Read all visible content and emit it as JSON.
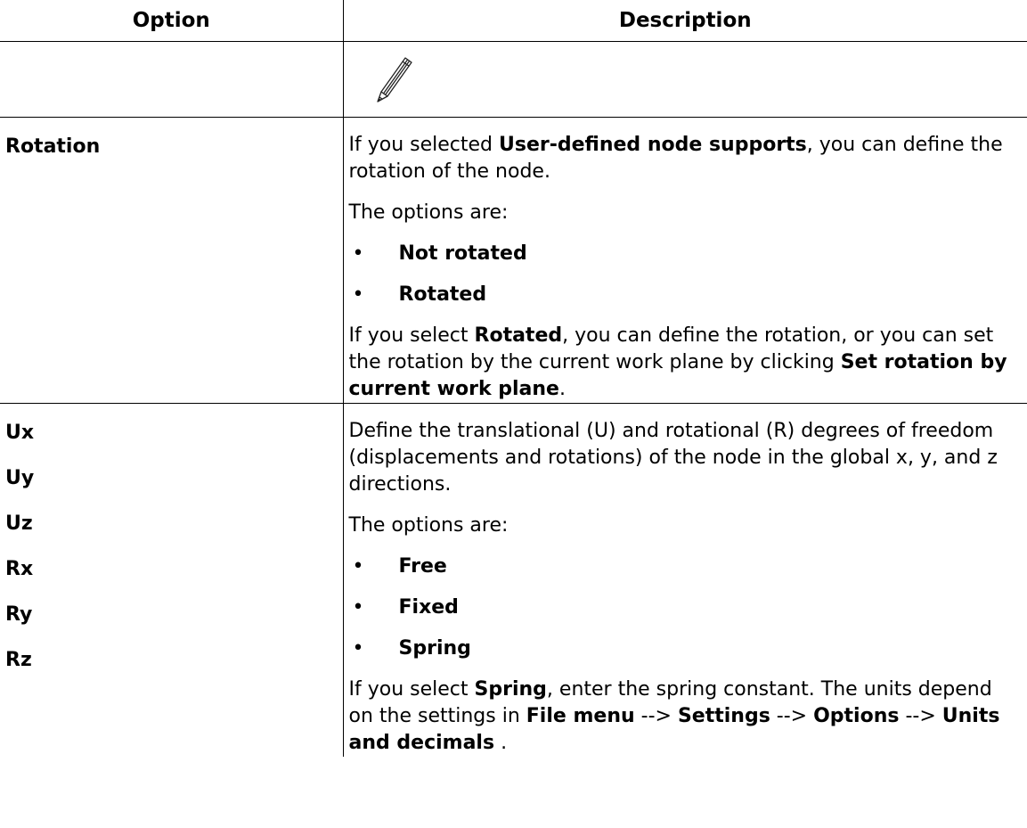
{
  "table": {
    "headers": {
      "option": "Option",
      "description": "Description"
    },
    "icon_row": {
      "icon": "pencil-icon"
    },
    "rotation_row": {
      "option": "Rotation",
      "p1": {
        "a": "If you selected ",
        "b": "User-defined node supports",
        "c": ", you can define the rotation of the node."
      },
      "intro": "The options are:",
      "bullets": [
        "Not rotated",
        "Rotated"
      ],
      "p2": {
        "a": "If you select ",
        "b": "Rotated",
        "c": ", you can define the rotation, or you can set the rotation by the current work plane by clicking ",
        "d": "Set rotation by current work plane",
        "e": "."
      }
    },
    "dof_row": {
      "options": [
        "Ux",
        "Uy",
        "Uz",
        "Rx",
        "Ry",
        "Rz"
      ],
      "p1": "Define the translational (U) and rotational (R) degrees of freedom (displacements and rotations) of the node in the global x, y, and z directions.",
      "intro": "The options are:",
      "bullets": [
        "Free",
        "Fixed",
        "Spring"
      ],
      "p2": {
        "a": "If you select ",
        "b": "Spring",
        "c": ", enter the spring constant. The units depend on the settings in ",
        "d": "File menu",
        "e": " --> ",
        "f": "Settings",
        "g": " --> ",
        "h": "Options",
        "i": " --> ",
        "j": "Units and decimals",
        "k": " ."
      }
    },
    "bullet_glyph": "•"
  }
}
